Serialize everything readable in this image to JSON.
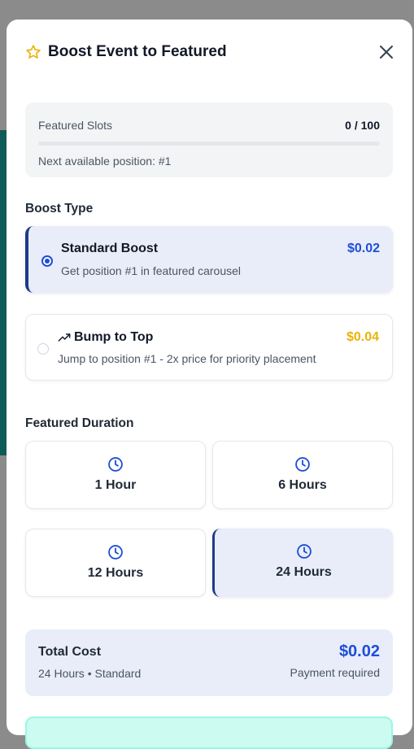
{
  "colors": {
    "accent": "#1d4ed8",
    "accent_dark": "#1e3a8a",
    "gold": "#eab308",
    "selected_bg": "#e8edf9",
    "teal_banner": "#ccfbf1"
  },
  "header": {
    "title": "Boost Event to Featured",
    "icon": "star-icon",
    "close_icon": "close-icon"
  },
  "slots": {
    "label": "Featured Slots",
    "count": "0 / 100",
    "fill_percent": 0,
    "next_position": "Next available position: #1"
  },
  "boost_type": {
    "title": "Boost Type",
    "options": [
      {
        "title": "Standard Boost",
        "description": "Get position #1 in featured carousel",
        "price": "$0.02",
        "selected": true
      },
      {
        "title": "Bump to Top",
        "icon": "trending-up-icon",
        "description": "Jump to position #1 - 2x price for priority placement",
        "price": "$0.04",
        "selected": false
      }
    ]
  },
  "duration": {
    "title": "Featured Duration",
    "options": [
      {
        "label": "1 Hour",
        "icon": "clock-icon",
        "selected": false
      },
      {
        "label": "6 Hours",
        "icon": "clock-icon",
        "selected": false
      },
      {
        "label": "12 Hours",
        "icon": "clock-icon",
        "selected": false
      },
      {
        "label": "24 Hours",
        "icon": "clock-icon",
        "selected": true
      }
    ]
  },
  "total": {
    "label": "Total Cost",
    "summary": "24 Hours • Standard",
    "price": "$0.02",
    "note": "Payment required"
  }
}
